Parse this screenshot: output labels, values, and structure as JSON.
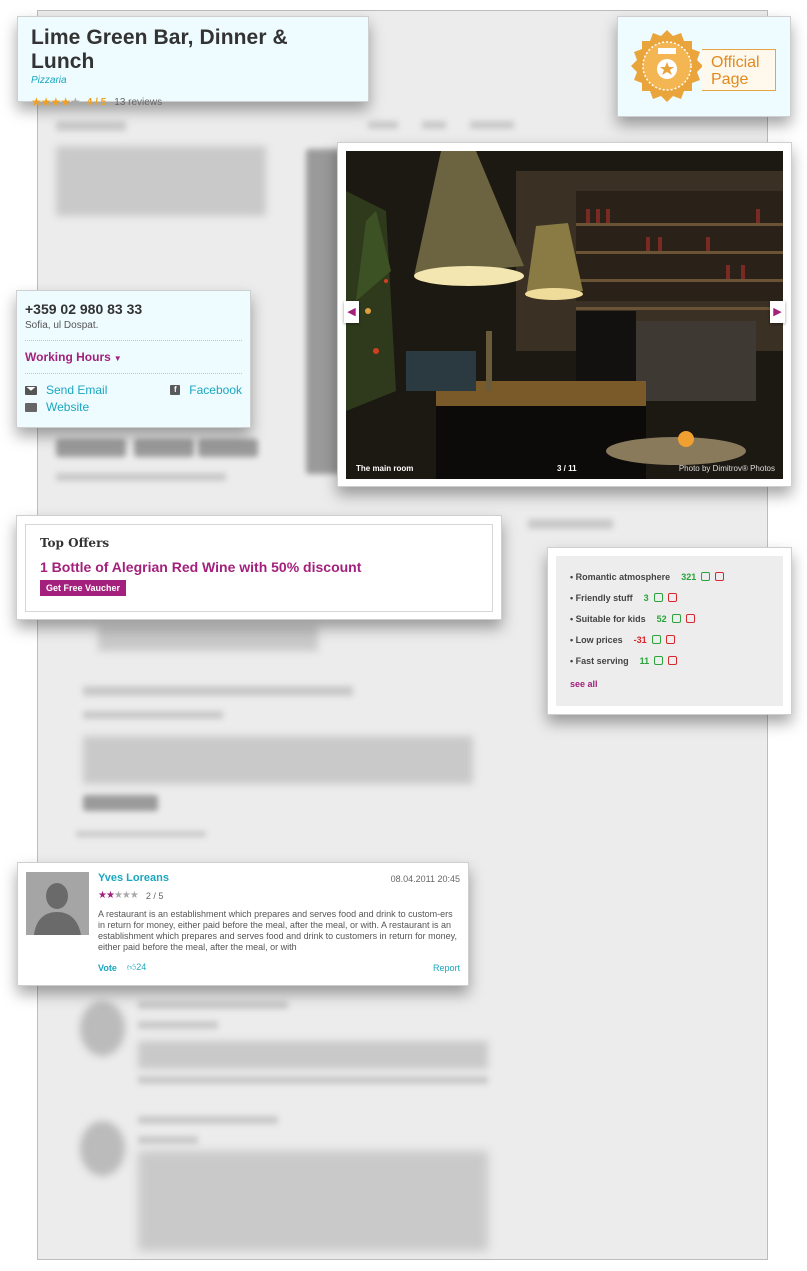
{
  "header": {
    "title": "Lime Green Bar, Dinner & Lunch",
    "category": "Pizzaria",
    "rating_value": "4 / 5",
    "rating_stars": 4,
    "reviews": "13 reviews"
  },
  "official": {
    "line1": "Official",
    "line2": "Page"
  },
  "contact": {
    "phone": "+359 02 980 83 33",
    "address": "Sofia, ul Dospat.",
    "working_hours": "Working Hours",
    "send_email": "Send Email",
    "facebook": "Facebook",
    "website": "Website"
  },
  "gallery": {
    "caption": "The main room",
    "counter": "3 / 11",
    "credit": "Photo by Dimitrov® Photos"
  },
  "offers": {
    "heading": "Top Offers",
    "offer": "1 Bottle of Alegrian Red Wine with 50% discount",
    "button": "Get Free Vaucher"
  },
  "traits": {
    "items": [
      {
        "label": "• Romantic atmosphere",
        "count": "321"
      },
      {
        "label": "• Friendly stuff",
        "count": "3"
      },
      {
        "label": "• Suitable for kids",
        "count": "52"
      },
      {
        "label": "• Low prices",
        "count": "-31"
      },
      {
        "label": "• Fast serving",
        "count": "11"
      }
    ],
    "see_all": "see all"
  },
  "review": {
    "name": "Yves Loreans",
    "date": "08.04.2011 20:45",
    "score": "2 / 5",
    "rating_stars": 2,
    "text": "A restaurant is an establishment which prepares and serves food and drink to custom-ers in return for money, either paid before the meal, after the meal, or with. A restaurant is an establishment which prepares and serves food and drink to customers in return for money, either paid before the meal, after the meal, or with",
    "vote": "Vote",
    "votes": "24",
    "report": "Report"
  },
  "colors": {
    "accent": "#a3217c",
    "link": "#1aa7c0",
    "star": "#f0a020",
    "positive": "#2aa43a",
    "negative": "#d9262c"
  }
}
